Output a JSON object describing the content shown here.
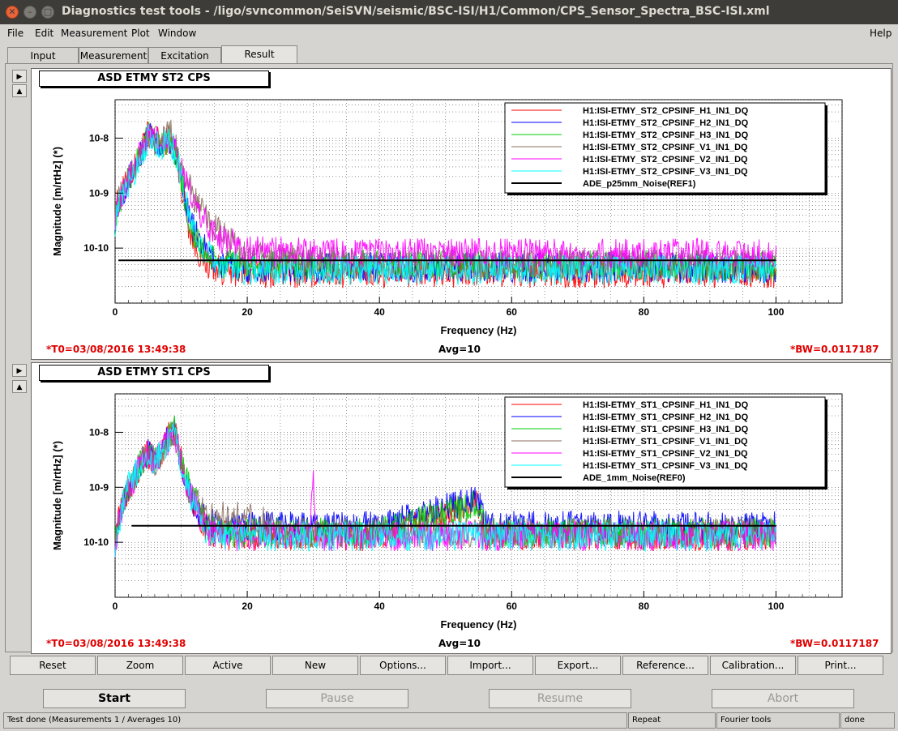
{
  "window": {
    "title": "Diagnostics test tools - /ligo/svncommon/SeiSVN/seismic/BSC-ISI/H1/Common/CPS_Sensor_Spectra_BSC-ISI.xml"
  },
  "menu": {
    "file": "File",
    "edit": "Edit",
    "measurement": "Measurement",
    "plot": "Plot",
    "window": "Window",
    "help": "Help"
  },
  "tabs": [
    "Input",
    "Measurement",
    "Excitation",
    "Result"
  ],
  "active_tab": "Result",
  "plots": [
    {
      "title": "ASD ETMY ST2 CPS",
      "legend": [
        {
          "name": "H1:ISI-ETMY_ST2_CPSINF_H1_IN1_DQ",
          "color": "#ff0000"
        },
        {
          "name": "H1:ISI-ETMY_ST2_CPSINF_H2_IN1_DQ",
          "color": "#0000ff"
        },
        {
          "name": "H1:ISI-ETMY_ST2_CPSINF_H3_IN1_DQ",
          "color": "#00cc00"
        },
        {
          "name": "H1:ISI-ETMY_ST2_CPSINF_V1_IN1_DQ",
          "color": "#8b6f5f"
        },
        {
          "name": "H1:ISI-ETMY_ST2_CPSINF_V2_IN1_DQ",
          "color": "#ff00ff"
        },
        {
          "name": "H1:ISI-ETMY_ST2_CPSINF_V3_IN1_DQ",
          "color": "#00ffff"
        },
        {
          "name": "ADE_p25mm_Noise(REF1)",
          "color": "#000000"
        }
      ],
      "t0": "*T0=03/08/2016 13:49:38",
      "avg": "Avg=10",
      "bw": "*BW=0.0117187"
    },
    {
      "title": "ASD ETMY ST1 CPS",
      "legend": [
        {
          "name": "H1:ISI-ETMY_ST1_CPSINF_H1_IN1_DQ",
          "color": "#ff0000"
        },
        {
          "name": "H1:ISI-ETMY_ST1_CPSINF_H2_IN1_DQ",
          "color": "#0000ff"
        },
        {
          "name": "H1:ISI-ETMY_ST1_CPSINF_H3_IN1_DQ",
          "color": "#00cc00"
        },
        {
          "name": "H1:ISI-ETMY_ST1_CPSINF_V1_IN1_DQ",
          "color": "#8b6f5f"
        },
        {
          "name": "H1:ISI-ETMY_ST1_CPSINF_V2_IN1_DQ",
          "color": "#ff00ff"
        },
        {
          "name": "H1:ISI-ETMY_ST1_CPSINF_V3_IN1_DQ",
          "color": "#00ffff"
        },
        {
          "name": "ADE_1mm_Noise(REF0)",
          "color": "#000000"
        }
      ],
      "t0": "*T0=03/08/2016 13:49:38",
      "avg": "Avg=10",
      "bw": "*BW=0.0117187"
    }
  ],
  "chart_data": [
    {
      "type": "line",
      "xlabel": "Frequency (Hz)",
      "ylabel": "Magnitude [m/rtHz] (*)",
      "x_ticks": [
        "0",
        "20",
        "40",
        "60",
        "80",
        "100"
      ],
      "y_ticks": [
        "10^-10",
        "10^-9",
        "10^-8"
      ],
      "xlim": [
        0,
        110
      ],
      "ylog": true,
      "ylim": [
        1e-11,
        5e-08
      ],
      "grid": true,
      "legend_position": "top-right",
      "series": [
        {
          "name": "H1:ISI-ETMY_ST2_CPSINF_H1_IN1_DQ",
          "color": "#ff0000",
          "x": [
            0,
            1,
            3,
            5,
            7,
            8,
            9,
            10,
            11,
            12,
            13,
            14,
            16,
            20,
            40,
            60,
            80,
            100
          ],
          "y": [
            5e-10,
            1e-09,
            3e-09,
            1.2e-08,
            8e-09,
            1e-08,
            6e-09,
            1.5e-09,
            3e-10,
            1.2e-10,
            7e-11,
            5e-11,
            4e-11,
            3.5e-11,
            3.5e-11,
            3.5e-11,
            3.5e-11,
            3.5e-11
          ]
        },
        {
          "name": "H1:ISI-ETMY_ST2_CPSINF_H2_IN1_DQ",
          "color": "#0000ff",
          "x": [
            0,
            1,
            3,
            5,
            7,
            8,
            9,
            10,
            11,
            12,
            13,
            14,
            16,
            20,
            40,
            60,
            80,
            100
          ],
          "y": [
            4e-10,
            1e-09,
            3e-09,
            1.1e-08,
            7e-09,
            1e-08,
            6e-09,
            2e-09,
            5e-10,
            2e-10,
            1.2e-10,
            8e-11,
            5e-11,
            4.5e-11,
            4.5e-11,
            4.5e-11,
            4.5e-11,
            4.2e-11
          ]
        },
        {
          "name": "H1:ISI-ETMY_ST2_CPSINF_H3_IN1_DQ",
          "color": "#00cc00",
          "x": [
            0,
            1,
            3,
            5,
            7,
            8,
            9,
            10,
            11,
            12,
            13,
            14,
            16,
            20,
            40,
            60,
            80,
            100
          ],
          "y": [
            4e-10,
            9e-10,
            3e-09,
            1.1e-08,
            7e-09,
            1e-08,
            6e-09,
            2e-09,
            4e-10,
            1.5e-10,
            1e-10,
            7e-11,
            5e-11,
            5e-11,
            5e-11,
            5e-11,
            5e-11,
            4.5e-11
          ]
        },
        {
          "name": "H1:ISI-ETMY_ST2_CPSINF_V1_IN1_DQ",
          "color": "#8b6f5f",
          "x": [
            0,
            1,
            3,
            5,
            7,
            8,
            9,
            10,
            11,
            12,
            13,
            14,
            16,
            20,
            40,
            60,
            80,
            100
          ],
          "y": [
            6e-10,
            1e-09,
            3e-09,
            1e-08,
            9e-09,
            1.4e-08,
            9e-09,
            3e-09,
            1.4e-09,
            8e-10,
            5e-10,
            3e-10,
            1.8e-10,
            7e-11,
            5e-11,
            5e-11,
            5e-11,
            5e-11
          ]
        },
        {
          "name": "H1:ISI-ETMY_ST2_CPSINF_V2_IN1_DQ",
          "color": "#ff00ff",
          "x": [
            0,
            1,
            3,
            5,
            7,
            8,
            9,
            10,
            11,
            12,
            13,
            14,
            16,
            20,
            40,
            60,
            80,
            100
          ],
          "y": [
            4e-10,
            1e-09,
            3e-09,
            1e-08,
            8e-09,
            1.2e-08,
            8e-09,
            3e-09,
            1.2e-09,
            6e-10,
            4e-10,
            2.5e-10,
            1.5e-10,
            9e-11,
            8e-11,
            8e-11,
            8e-11,
            8e-11
          ]
        },
        {
          "name": "H1:ISI-ETMY_ST2_CPSINF_V3_IN1_DQ",
          "color": "#00ffff",
          "x": [
            0,
            1,
            3,
            5,
            7,
            8,
            9,
            10,
            11,
            12,
            13,
            14,
            16,
            20,
            40,
            60,
            80,
            100
          ],
          "y": [
            3e-10,
            8e-10,
            2.5e-09,
            1e-08,
            7e-09,
            1e-08,
            6e-09,
            2e-09,
            5e-10,
            2e-10,
            1.2e-10,
            8e-11,
            5e-11,
            4e-11,
            4e-11,
            4e-11,
            4e-11,
            4e-11
          ]
        },
        {
          "name": "ADE_p25mm_Noise(REF1)",
          "color": "#000000",
          "x": [
            0.5,
            100
          ],
          "y": [
            6e-11,
            6e-11
          ]
        }
      ]
    },
    {
      "type": "line",
      "xlabel": "Frequency (Hz)",
      "ylabel": "Magnitude [m/rtHz] (*)",
      "x_ticks": [
        "0",
        "20",
        "40",
        "60",
        "80",
        "100"
      ],
      "y_ticks": [
        "10^-10",
        "10^-9",
        "10^-8"
      ],
      "xlim": [
        0,
        110
      ],
      "ylog": true,
      "ylim": [
        1e-11,
        5e-08
      ],
      "grid": true,
      "legend_position": "top-right",
      "series": [
        {
          "name": "H1:ISI-ETMY_ST1_CPSINF_H1_IN1_DQ",
          "color": "#ff0000",
          "x": [
            0,
            1,
            2,
            3,
            4,
            5,
            6,
            7,
            8,
            9,
            10,
            11,
            12,
            13,
            14,
            16,
            20,
            40,
            55,
            56,
            60,
            80,
            100
          ],
          "y": [
            1e-10,
            5e-10,
            1e-09,
            1.6e-09,
            3e-09,
            4e-09,
            3e-09,
            4e-09,
            8e-09,
            1.2e-08,
            3e-09,
            1e-09,
            5e-10,
            2.5e-10,
            1.6e-10,
            1.3e-10,
            1.3e-10,
            1.3e-10,
            5e-10,
            1.3e-10,
            1.3e-10,
            1.3e-10,
            1.3e-10
          ]
        },
        {
          "name": "H1:ISI-ETMY_ST1_CPSINF_H2_IN1_DQ",
          "color": "#0000ff",
          "x": [
            0,
            1,
            2,
            3,
            4,
            5,
            6,
            7,
            8,
            9,
            10,
            11,
            12,
            13,
            14,
            16,
            20,
            40,
            55,
            56,
            60,
            80,
            100
          ],
          "y": [
            1e-10,
            5e-10,
            1e-09,
            1.6e-09,
            3e-09,
            4e-09,
            3e-09,
            4e-09,
            8e-09,
            1.2e-08,
            3e-09,
            1e-09,
            5e-10,
            3e-10,
            2.2e-10,
            2e-10,
            2e-10,
            2e-10,
            6e-10,
            2e-10,
            2e-10,
            2e-10,
            2e-10
          ]
        },
        {
          "name": "H1:ISI-ETMY_ST1_CPSINF_H3_IN1_DQ",
          "color": "#00cc00",
          "x": [
            0,
            1,
            2,
            3,
            4,
            5,
            6,
            7,
            8,
            9,
            10,
            11,
            12,
            13,
            14,
            16,
            20,
            40,
            55,
            56,
            60,
            80,
            100
          ],
          "y": [
            1e-10,
            5e-10,
            1e-09,
            1.6e-09,
            3e-09,
            4e-09,
            3e-09,
            4e-09,
            8e-09,
            1.2e-08,
            3e-09,
            1.2e-09,
            7e-10,
            4e-10,
            2e-10,
            1.5e-10,
            1.5e-10,
            1.5e-10,
            5e-10,
            1.5e-10,
            1.5e-10,
            1.5e-10,
            1.5e-10
          ]
        },
        {
          "name": "H1:ISI-ETMY_ST1_CPSINF_V1_IN1_DQ",
          "color": "#8b6f5f",
          "x": [
            0,
            1,
            2,
            3,
            4,
            5,
            6,
            7,
            8,
            9,
            10,
            11,
            12,
            13,
            14,
            16,
            18,
            20,
            22,
            23,
            24,
            40,
            60,
            80,
            100
          ],
          "y": [
            1e-10,
            4e-10,
            1e-09,
            1.6e-09,
            3e-09,
            4e-09,
            3e-09,
            4e-09,
            7e-09,
            1e-08,
            3e-09,
            1e-09,
            6e-10,
            4e-10,
            3e-10,
            3e-10,
            3e-10,
            2.8e-10,
            2.5e-10,
            2.2e-10,
            1.5e-10,
            1.5e-10,
            1.5e-10,
            1.5e-10,
            1.5e-10
          ]
        },
        {
          "name": "H1:ISI-ETMY_ST1_CPSINF_V2_IN1_DQ",
          "color": "#ff00ff",
          "x": [
            0,
            1,
            2,
            3,
            4,
            5,
            6,
            7,
            8,
            9,
            10,
            11,
            12,
            13,
            14,
            16,
            20,
            29.5,
            30,
            30.5,
            40,
            55,
            56,
            60,
            80,
            100
          ],
          "y": [
            1e-10,
            4e-10,
            1e-09,
            1.6e-09,
            3e-09,
            4e-09,
            3e-09,
            4e-09,
            7e-09,
            1e-08,
            3e-09,
            1e-09,
            5e-10,
            2.5e-10,
            1.6e-10,
            1.3e-10,
            1.3e-10,
            1.3e-10,
            1.2e-09,
            1.3e-10,
            1.3e-10,
            1.3e-10,
            1.3e-10,
            1.3e-10,
            1.3e-10,
            1.3e-10
          ]
        },
        {
          "name": "H1:ISI-ETMY_ST1_CPSINF_V3_IN1_DQ",
          "color": "#00ffff",
          "x": [
            0,
            1,
            2,
            3,
            4,
            5,
            6,
            7,
            8,
            9,
            10,
            11,
            12,
            13,
            14,
            16,
            20,
            40,
            60,
            80,
            100
          ],
          "y": [
            1e-10,
            4e-10,
            1e-09,
            1.6e-09,
            3e-09,
            4e-09,
            3e-09,
            4e-09,
            7e-09,
            1e-08,
            3e-09,
            1e-09,
            5e-10,
            2.5e-10,
            1.6e-10,
            1.3e-10,
            1.3e-10,
            1.3e-10,
            1.3e-10,
            1.3e-10,
            1.3e-10
          ]
        },
        {
          "name": "ADE_1mm_Noise(REF0)",
          "color": "#000000",
          "x": [
            2.5,
            100
          ],
          "y": [
            2e-10,
            2e-10
          ]
        }
      ]
    }
  ],
  "controls": [
    "Reset",
    "Zoom",
    "Active",
    "New",
    "Options...",
    "Import...",
    "Export...",
    "Reference...",
    "Calibration...",
    "Print..."
  ],
  "run_buttons": {
    "start": "Start",
    "pause": "Pause",
    "resume": "Resume",
    "abort": "Abort"
  },
  "status": {
    "message": "Test done (Measurements 1 / Averages 10)",
    "mode": "Repeat",
    "tool": "Fourier tools",
    "state": "done"
  }
}
